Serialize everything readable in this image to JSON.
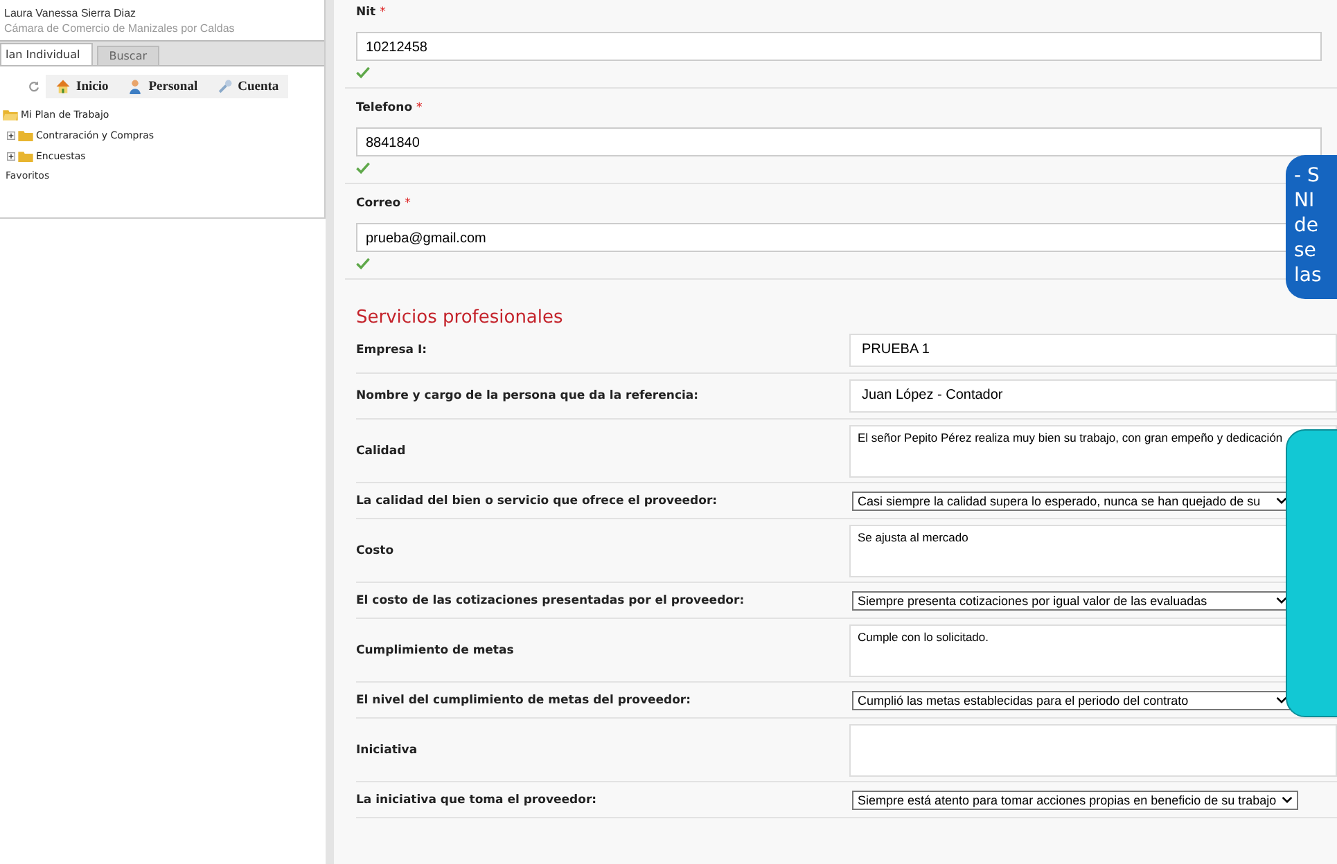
{
  "sidebar": {
    "user_name": "Laura Vanessa Sierra Diaz",
    "organization": "Cámara de Comercio de Manizales por Caldas",
    "tabs": [
      {
        "label": "lan Individual",
        "selected": true
      },
      {
        "label": "Buscar",
        "selected": false
      }
    ],
    "toolbar": [
      {
        "label": "Inicio",
        "kind": "home"
      },
      {
        "label": "Personal",
        "kind": "person"
      },
      {
        "label": "Cuenta",
        "kind": "wrench"
      }
    ],
    "tree": [
      {
        "label": "Mi Plan de Trabajo",
        "expanded": true,
        "children": [
          {
            "label": "Contraración y Compras",
            "expanded": false
          },
          {
            "label": "Encuestas",
            "expanded": false
          }
        ]
      }
    ],
    "favorites": "Favoritos"
  },
  "contact_fields": [
    {
      "label": "Nit",
      "required_mark": "*",
      "value": "10212458",
      "valid": true
    },
    {
      "label": "Telefono",
      "required_mark": "*",
      "value": "8841840",
      "valid": true
    },
    {
      "label": "Correo",
      "required_mark": "*",
      "value": "prueba@gmail.com",
      "valid": true
    }
  ],
  "section_title": "Servicios profesionales",
  "form_rows": [
    {
      "kind": "input",
      "label": "Empresa I:",
      "value": "PRUEBA 1"
    },
    {
      "kind": "input",
      "label": "Nombre y cargo de la persona que da la referencia:",
      "value": "Juan López - Contador"
    },
    {
      "kind": "textarea",
      "label": "Calidad",
      "value": "El señor Pepito Pérez realiza muy bien su trabajo, con gran empeño y dedicación"
    },
    {
      "kind": "select",
      "label": "La calidad del bien o servicio que ofrece el proveedor:",
      "value": "Casi siempre la calidad supera lo esperado, nunca se han quejado de su"
    },
    {
      "kind": "textarea",
      "label": "Costo",
      "value": "Se ajusta al mercado"
    },
    {
      "kind": "select",
      "label": "El costo de las cotizaciones presentadas por el proveedor:",
      "value": "Siempre presenta cotizaciones por igual valor de las evaluadas"
    },
    {
      "kind": "textarea",
      "label": "Cumplimiento de metas",
      "value": "Cumple con lo solicitado."
    },
    {
      "kind": "select",
      "label": "El nivel del cumplimiento de metas del proveedor:",
      "value": "Cumplió las metas establecidas para el periodo del contrato"
    },
    {
      "kind": "textarea",
      "label": "Iniciativa",
      "value": ""
    },
    {
      "kind": "select",
      "label": "La iniciativa que toma el proveedor:",
      "value": "Siempre está atento para tomar acciones propias en beneficio de su trabajo"
    }
  ],
  "callouts": [
    {
      "kind": "blue",
      "lines": [
        "- S",
        "NI",
        "de",
        "se",
        "las"
      ]
    },
    {
      "kind": "teal"
    }
  ]
}
